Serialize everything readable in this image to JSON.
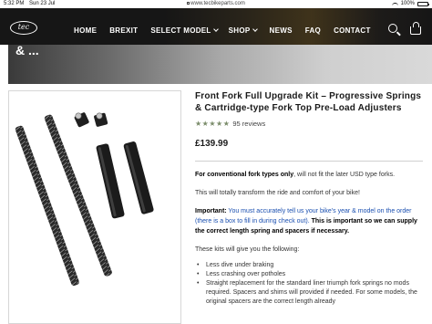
{
  "status_bar": {
    "time": "5:32 PM",
    "date": "Sun 23 Jul",
    "url": "www.tecbikeparts.com",
    "battery": "100%"
  },
  "nav": {
    "logo_text": "tec",
    "items": [
      {
        "label": "HOME",
        "dropdown": false
      },
      {
        "label": "BREXIT",
        "dropdown": false
      },
      {
        "label": "SELECT MODEL",
        "dropdown": true
      },
      {
        "label": "SHOP",
        "dropdown": true
      },
      {
        "label": "NEWS",
        "dropdown": false
      },
      {
        "label": "FAQ",
        "dropdown": false
      },
      {
        "label": "CONTACT",
        "dropdown": false
      }
    ]
  },
  "hero": {
    "text": "& ..."
  },
  "product": {
    "title": "Front Fork Full Upgrade Kit – Progressive Springs & Cartridge-type Fork Top Pre-Load Adjusters",
    "stars": "★★★★★",
    "rating_value": 5,
    "reviews": "95 reviews",
    "price": "£139.99",
    "desc_bold": "For conventional fork types only",
    "desc_rest": ", will not fit the later USD type forks.",
    "desc_2": "This will totally transform the ride and comfort of your bike!",
    "important_label": "Important:",
    "important_blue": " You must accurately tell us your bike's year & model on the order (there is a box to fill in during check out).",
    "important_bold": "This is important so we can supply the correct length spring and spacers if necessary.",
    "kit_intro": "These kits will give you the following:",
    "bullets": [
      "Less dive under braking",
      "Less crashing over potholes",
      "Straight replacement for the standard liner triumph fork springs no mods required.  Spacers and shims will provided if needed.  For some models, the original spacers are the correct length already"
    ]
  },
  "colors": {
    "nav_bg": "#161616",
    "star": "#7a8c6a",
    "link_blue": "#1a4fb0"
  }
}
